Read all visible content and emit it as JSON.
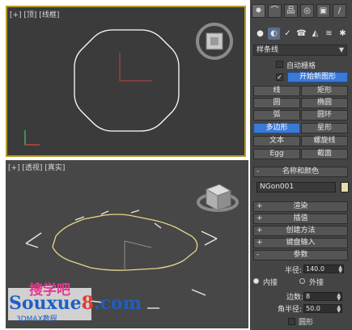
{
  "viewports": {
    "top_label": "[+] [顶] [线框]",
    "persp_label": "[+] [透视] [真实]"
  },
  "panel": {
    "tabs": [
      {
        "icon": "create-icon",
        "glyph": "✸"
      },
      {
        "icon": "modify-icon",
        "glyph": "⌒"
      },
      {
        "icon": "hierarchy-icon",
        "glyph": "品"
      },
      {
        "icon": "motion-icon",
        "glyph": "◎"
      },
      {
        "icon": "display-icon",
        "glyph": "▣"
      },
      {
        "icon": "utilities-icon",
        "glyph": "/"
      }
    ],
    "categories": [
      {
        "icon": "geometry-icon",
        "glyph": "●"
      },
      {
        "icon": "shapes-icon",
        "glyph": "◐"
      },
      {
        "icon": "lights-icon",
        "glyph": "✓"
      },
      {
        "icon": "cameras-icon",
        "glyph": "☎"
      },
      {
        "icon": "helpers-icon",
        "glyph": "◭"
      },
      {
        "icon": "spacewarps-icon",
        "glyph": "≋"
      },
      {
        "icon": "systems-icon",
        "glyph": "✱"
      }
    ],
    "dropdown_value": "样条线",
    "autogrid_label": "自动栅格",
    "start_new_shape_label": "开始新图形",
    "start_new_shape_checked": "✓",
    "object_types": [
      "线",
      "矩形",
      "圆",
      "椭圆",
      "弧",
      "圆环",
      "多边形",
      "星形",
      "文本",
      "螺旋线",
      "Egg",
      "截面"
    ],
    "name_color_title": "名称和颜色",
    "object_name": "NGon001",
    "name_color": "#e8dcb0",
    "rollouts": [
      "渲染",
      "插值",
      "创建方法",
      "键盘输入"
    ],
    "params_title": "参数",
    "radius_label": "半径:",
    "radius_value": "140.0",
    "inscribed_label": "内接",
    "circumscribed_label": "外接",
    "sides_label": "边数:",
    "sides_value": "8",
    "corner_radius_label": "角半径:",
    "corner_radius_value": "50.0",
    "circular_label": "圆形",
    "plus_sign": "+",
    "minus_sign": "-",
    "accent_color": "#3a79d6"
  },
  "watermark": {
    "top": "搜学吧",
    "main_prefix": "Souxue",
    "main_num": "8",
    "main_suffix": ".com",
    "sub": "3DMAX教程"
  }
}
